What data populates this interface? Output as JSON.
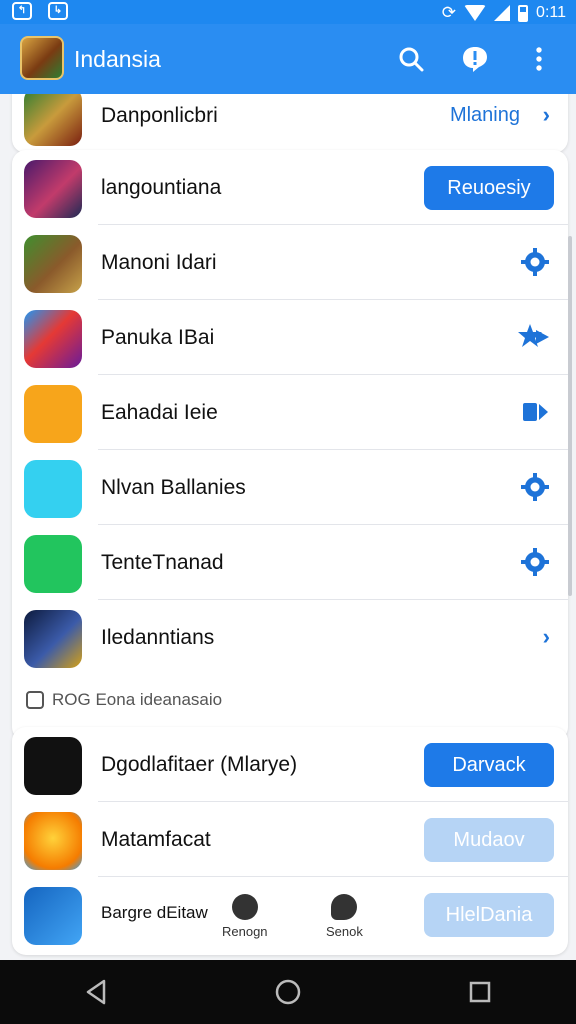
{
  "status_bar": {
    "time": "0:11"
  },
  "app_bar": {
    "title": "Indansia"
  },
  "icons": {
    "search": "search-icon",
    "alert": "alert-bubble-icon",
    "more": "more-vert-icon"
  },
  "colors": {
    "accent": "#1e7ae8",
    "app_bar": "#2a8df2",
    "disabled_button": "#b6d4f5"
  },
  "items": [
    {
      "title": "Danponlicbri",
      "action_type": "link",
      "action_label": "Mlaning"
    },
    {
      "title": "langountiana",
      "action_type": "button",
      "action_label": "Reuoesiy"
    },
    {
      "title": "Manoni Idari",
      "action_type": "icon",
      "icon": "settings-icon"
    },
    {
      "title": "Panuka IBai",
      "action_type": "icon",
      "icon": "star-arrow-icon"
    },
    {
      "title": "Eahadai Ieie",
      "action_type": "icon",
      "icon": "forward-icon"
    },
    {
      "title": "Nlvan Ballanies",
      "action_type": "icon",
      "icon": "settings-icon"
    },
    {
      "title": "TenteTnanad",
      "action_type": "icon",
      "icon": "settings-icon"
    },
    {
      "title": "Iledanntians",
      "action_type": "chevron"
    }
  ],
  "section": {
    "label": "ROG Eona ideanasaio"
  },
  "section_items": [
    {
      "title": "Dgodlafitaer (Mlarye)",
      "action_label": "Darvack",
      "enabled": true
    },
    {
      "title": "Matamfacat",
      "action_label": "Mudaov",
      "enabled": false
    },
    {
      "title": "Bargre dEitaw",
      "action_label": "HlelDania",
      "enabled": false
    }
  ],
  "floating_tabs": [
    {
      "label": "Renogn",
      "icon": "globe-icon"
    },
    {
      "label": "Senok",
      "icon": "chat-icon"
    }
  ],
  "nav": {
    "back": "back-icon",
    "home": "home-icon",
    "recents": "recents-icon"
  }
}
